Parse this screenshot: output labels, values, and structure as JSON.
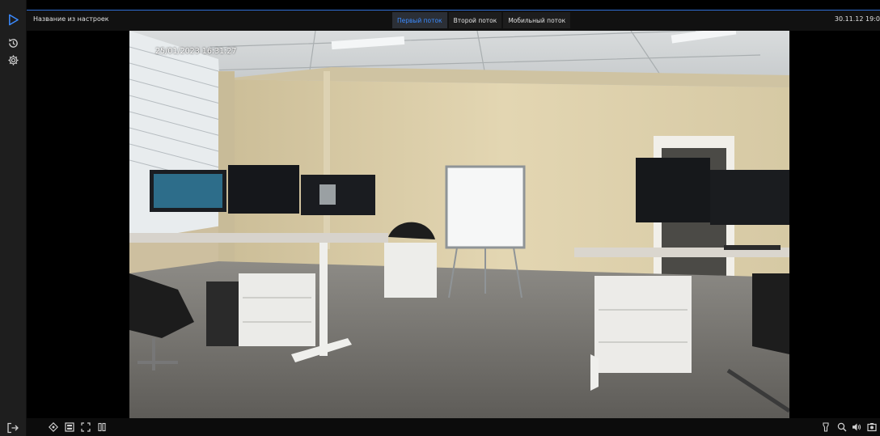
{
  "sidebar": {
    "items": [
      {
        "name": "live",
        "icon": "play-icon"
      },
      {
        "name": "archive",
        "icon": "history-icon"
      },
      {
        "name": "settings",
        "icon": "gear-icon"
      }
    ],
    "logout_icon": "logout-icon"
  },
  "header": {
    "camera_title": "Название из настроек",
    "tabs": [
      {
        "label": "Первый поток",
        "active": true
      },
      {
        "label": "Второй поток",
        "active": false
      },
      {
        "label": "Мобильный поток",
        "active": false
      }
    ],
    "clock": "30.11.12 19:0"
  },
  "video": {
    "osd_timestamp": "25/01/2023 16:31:27"
  },
  "toolbar": {
    "left_icons": [
      "ptz-icon",
      "layout-icon",
      "fullscreen-icon",
      "pause-icon"
    ],
    "right_icons": [
      "flashlight-icon",
      "zoom-icon",
      "volume-icon",
      "snapshot-icon"
    ]
  },
  "colors": {
    "accent": "#3b8bff",
    "sidebar_bg": "#1e1e1e",
    "header_bg": "#111111"
  }
}
